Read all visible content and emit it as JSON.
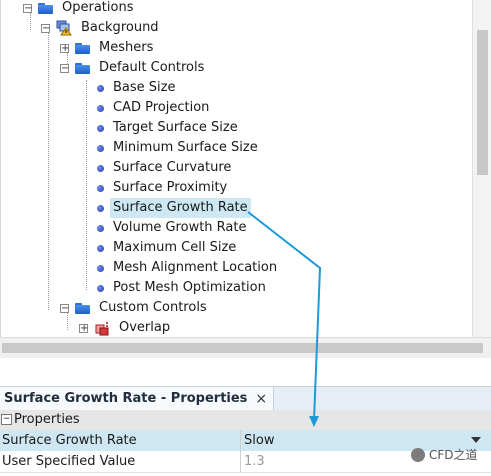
{
  "tree": {
    "items": [
      {
        "label": "Operations",
        "kind": "folder",
        "expander": "−"
      },
      {
        "label": "Background",
        "kind": "warn",
        "expander": "−"
      },
      {
        "label": "Meshers",
        "kind": "folder",
        "expander": "+"
      },
      {
        "label": "Default Controls",
        "kind": "folder",
        "expander": "−"
      },
      {
        "label": "Base Size",
        "kind": "dot"
      },
      {
        "label": "CAD Projection",
        "kind": "dot"
      },
      {
        "label": "Target Surface Size",
        "kind": "dot"
      },
      {
        "label": "Minimum Surface Size",
        "kind": "dot"
      },
      {
        "label": "Surface Curvature",
        "kind": "dot"
      },
      {
        "label": "Surface Proximity",
        "kind": "dot"
      },
      {
        "label": "Surface Growth Rate",
        "kind": "dot",
        "selected": true
      },
      {
        "label": "Volume Growth Rate",
        "kind": "dot"
      },
      {
        "label": "Maximum Cell Size",
        "kind": "dot"
      },
      {
        "label": "Mesh Alignment Location",
        "kind": "dot"
      },
      {
        "label": "Post Mesh Optimization",
        "kind": "dot"
      },
      {
        "label": "Custom Controls",
        "kind": "folder",
        "expander": "−"
      },
      {
        "label": "Overlap",
        "kind": "mesh",
        "expander": "+"
      }
    ]
  },
  "properties": {
    "tab_title": "Surface Growth Rate - Properties",
    "close": "×",
    "section": "Properties",
    "section_toggle": "−",
    "rows": [
      {
        "name": "Surface Growth Rate",
        "value": "Slow"
      },
      {
        "name": "User Specified Value",
        "value": "1.3"
      }
    ]
  },
  "watermark": "CFD之道",
  "colors": {
    "accent_arrow": "#1e9ad6",
    "selection": "#cde8f3",
    "folder": "#2e6fd0"
  }
}
